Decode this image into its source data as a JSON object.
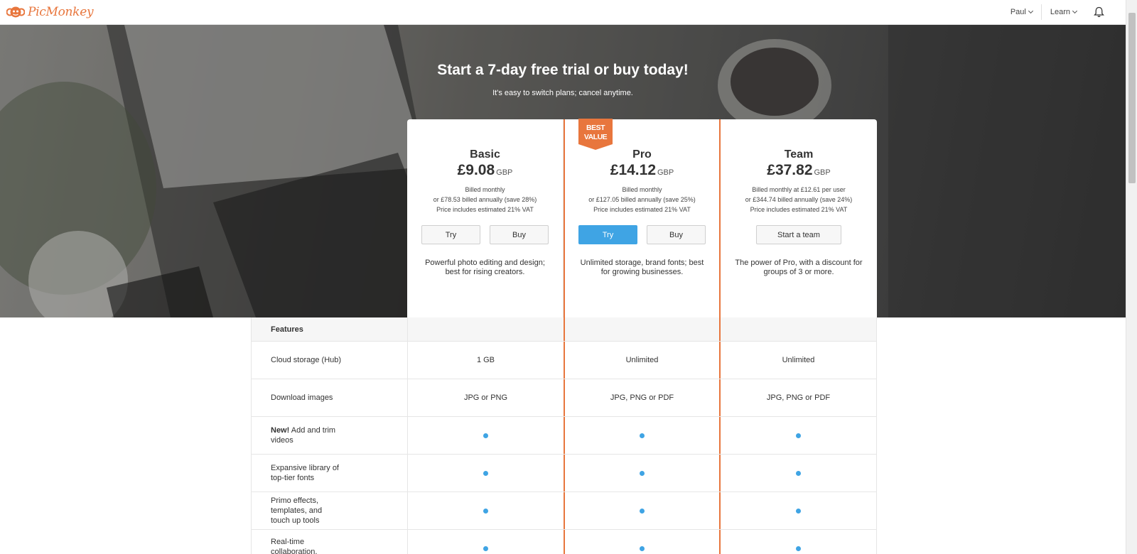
{
  "nav": {
    "logo_text": "PicMonkey",
    "user_label": "Paul",
    "learn_label": "Learn"
  },
  "hero": {
    "title": "Start a 7-day free trial or buy today!",
    "subtitle": "It's easy to switch plans; cancel anytime."
  },
  "plans": [
    {
      "name": "Basic",
      "price": "£9.08",
      "currency": "GBP",
      "billing_1": "Billed monthly",
      "billing_2": "or £78.53 billed annually (save 28%)",
      "billing_3": "Price includes estimated 21% VAT",
      "try_label": "Try",
      "buy_label": "Buy",
      "description": "Powerful photo editing and design; best for rising creators."
    },
    {
      "name": "Pro",
      "badge": "BEST VALUE",
      "price": "£14.12",
      "currency": "GBP",
      "billing_1": "Billed monthly",
      "billing_2": "or £127.05 billed annually (save 25%)",
      "billing_3": "Price includes estimated 21% VAT",
      "try_label": "Try",
      "buy_label": "Buy",
      "description": "Unlimited storage, brand fonts; best for growing businesses."
    },
    {
      "name": "Team",
      "price": "£37.82",
      "currency": "GBP",
      "billing_1": "Billed monthly at £12.61 per user",
      "billing_2": "or £344.74 billed annually (save 24%)",
      "billing_3": "Price includes estimated 21% VAT",
      "team_label": "Start a team",
      "description": "The power of Pro, with a discount for groups of 3 or more."
    }
  ],
  "features": {
    "header": "Features",
    "rows": [
      {
        "label": "Cloud storage (Hub)",
        "basic": "1 GB",
        "pro": "Unlimited",
        "team": "Unlimited"
      },
      {
        "label": "Download images",
        "basic": "JPG or PNG",
        "pro": "JPG, PNG or PDF",
        "team": "JPG, PNG or PDF"
      },
      {
        "new_tag": "New!",
        "label": "Add and trim videos"
      },
      {
        "label": "Expansive library of top-tier fonts"
      },
      {
        "label": "Primo effects, templates, and touch up tools"
      },
      {
        "label": "Real-time collaboration, shared folders"
      }
    ]
  },
  "colors": {
    "brand_orange": "#e8763d",
    "accent_blue": "#3fa4e4"
  }
}
